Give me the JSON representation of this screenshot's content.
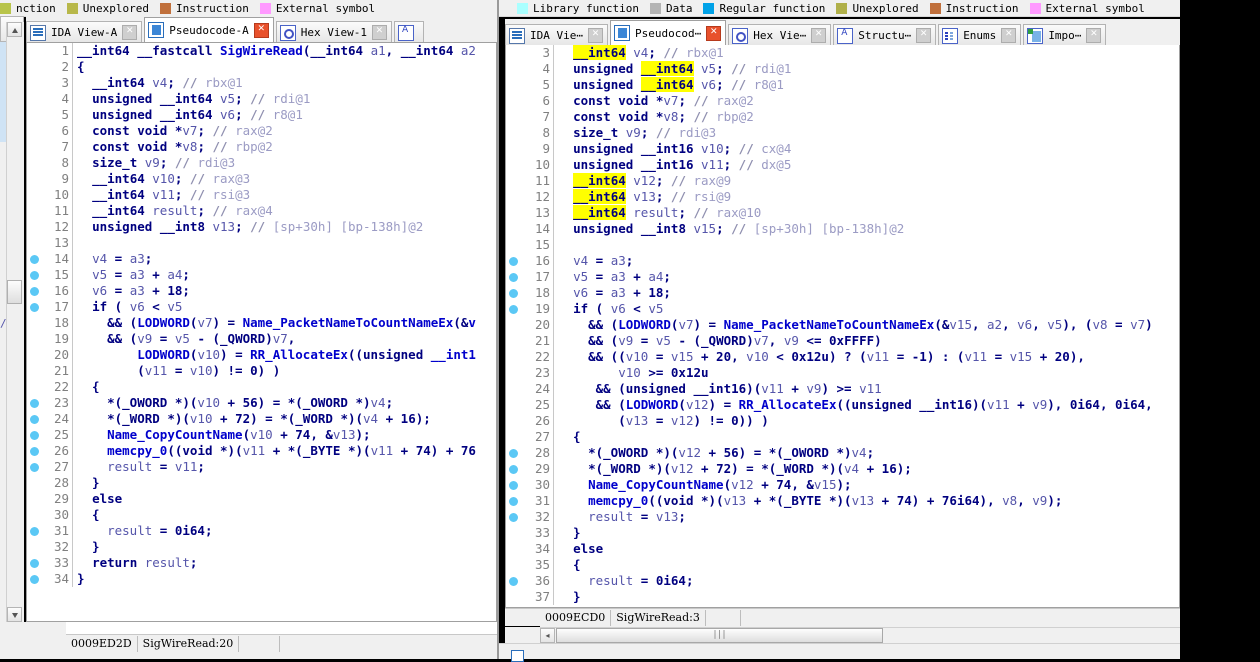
{
  "legend": {
    "left_items": [
      {
        "label": "nction",
        "color": "#b8c44a"
      },
      {
        "label": "Unexplored",
        "color": "#b8b84a"
      },
      {
        "label": "Instruction",
        "color": "#c0703c"
      },
      {
        "label": "External symbol",
        "color": "#ff99ff"
      }
    ],
    "right_items": [
      {
        "label": "Library function",
        "color": "#aaffff"
      },
      {
        "label": "Data",
        "color": "#b4b4b4"
      },
      {
        "label": "Regular function",
        "color": "#00a2e8"
      },
      {
        "label": "Unexplored",
        "color": "#b0b04a"
      },
      {
        "label": "Instruction",
        "color": "#c0703c"
      },
      {
        "label": "External symbol",
        "color": "#ff99ff"
      }
    ]
  },
  "left_window": {
    "close_button": "✕",
    "tabs": [
      {
        "label": "IDA View-A",
        "icon": "document-icon",
        "active": false,
        "close": "✕"
      },
      {
        "label": "Pseudocode-A",
        "icon": "pseudocode-icon",
        "active": true,
        "close": "✕"
      },
      {
        "label": "Hex View-1",
        "icon": "hexview-icon",
        "active": false,
        "close": "✕"
      },
      {
        "label": "",
        "icon": "structures-icon",
        "active": false,
        "close": ""
      }
    ],
    "status": {
      "address": "0009ED2D",
      "location": "SigWireRead:20"
    },
    "code": [
      {
        "n": 1,
        "bp": false,
        "text": "__int64 __fastcall SigWireRead(__int64 a1, __int64 a2"
      },
      {
        "n": 2,
        "bp": false,
        "text": "{"
      },
      {
        "n": 3,
        "bp": false,
        "text": "  __int64 v4; // rbx@1"
      },
      {
        "n": 4,
        "bp": false,
        "text": "  unsigned __int64 v5; // rdi@1"
      },
      {
        "n": 5,
        "bp": false,
        "text": "  unsigned __int64 v6; // r8@1"
      },
      {
        "n": 6,
        "bp": false,
        "text": "  const void *v7; // rax@2"
      },
      {
        "n": 7,
        "bp": false,
        "text": "  const void *v8; // rbp@2"
      },
      {
        "n": 8,
        "bp": false,
        "text": "  size_t v9; // rdi@3"
      },
      {
        "n": 9,
        "bp": false,
        "text": "  __int64 v10; // rax@3"
      },
      {
        "n": 10,
        "bp": false,
        "text": "  __int64 v11; // rsi@3"
      },
      {
        "n": 11,
        "bp": false,
        "text": "  __int64 result; // rax@4"
      },
      {
        "n": 12,
        "bp": false,
        "text": "  unsigned __int8 v13; // [sp+30h] [bp-138h]@2"
      },
      {
        "n": 13,
        "bp": false,
        "text": ""
      },
      {
        "n": 14,
        "bp": true,
        "text": "  v4 = a3;"
      },
      {
        "n": 15,
        "bp": true,
        "text": "  v5 = a3 + a4;"
      },
      {
        "n": 16,
        "bp": true,
        "text": "  v6 = a3 + 18;"
      },
      {
        "n": 17,
        "bp": true,
        "text": "  if ( v6 < v5"
      },
      {
        "n": 18,
        "bp": false,
        "text": "    && (LODWORD(v7) = Name_PacketNameToCountNameEx(&v"
      },
      {
        "n": 19,
        "bp": false,
        "text": "    && (v9 = v5 - (_QWORD)v7,"
      },
      {
        "n": 20,
        "bp": false,
        "text": "        LODWORD(v10) = RR_AllocateEx((unsigned __int1"
      },
      {
        "n": 21,
        "bp": false,
        "text": "        (v11 = v10) != 0) )"
      },
      {
        "n": 22,
        "bp": false,
        "text": "  {"
      },
      {
        "n": 23,
        "bp": true,
        "text": "    *(_OWORD *)(v10 + 56) = *(_OWORD *)v4;"
      },
      {
        "n": 24,
        "bp": true,
        "text": "    *(_WORD *)(v10 + 72) = *(_WORD *)(v4 + 16);"
      },
      {
        "n": 25,
        "bp": true,
        "text": "    Name_CopyCountName(v10 + 74, &v13);"
      },
      {
        "n": 26,
        "bp": true,
        "text": "    memcpy_0((void *)(v11 + *(_BYTE *)(v11 + 74) + 76"
      },
      {
        "n": 27,
        "bp": true,
        "text": "    result = v11;"
      },
      {
        "n": 28,
        "bp": false,
        "text": "  }"
      },
      {
        "n": 29,
        "bp": false,
        "text": "  else"
      },
      {
        "n": 30,
        "bp": false,
        "text": "  {"
      },
      {
        "n": 31,
        "bp": true,
        "text": "    result = 0i64;"
      },
      {
        "n": 32,
        "bp": false,
        "text": "  }"
      },
      {
        "n": 33,
        "bp": true,
        "text": "  return result;"
      },
      {
        "n": 34,
        "bp": true,
        "text": "}"
      }
    ]
  },
  "right_window": {
    "tabs": [
      {
        "label": "IDA Vie⋯",
        "icon": "document-icon",
        "active": false,
        "close": "✕"
      },
      {
        "label": "Pseudocod⋯",
        "icon": "pseudocode-icon",
        "active": true,
        "close": "✕"
      },
      {
        "label": "Hex Vie⋯",
        "icon": "hexview-icon",
        "active": false,
        "close": "✕"
      },
      {
        "label": "Structu⋯",
        "icon": "structures-icon",
        "active": false,
        "close": "✕"
      },
      {
        "label": "Enums",
        "icon": "enums-icon",
        "active": false,
        "close": "✕"
      },
      {
        "label": "Impo⋯",
        "icon": "imports-icon",
        "active": false,
        "close": "✕"
      }
    ],
    "status": {
      "address": "0009ECD0",
      "location": "SigWireRead:3"
    },
    "hscroll": {
      "grip": "∣∣∣",
      "left_arrow": "◂"
    },
    "code": [
      {
        "n": 3,
        "bp": false,
        "text": "  __int64 v4; // rbx@1",
        "hl": [
          {
            "s": 2,
            "e": 9
          }
        ]
      },
      {
        "n": 4,
        "bp": false,
        "text": "  unsigned __int64 v5; // rdi@1",
        "hl": [
          {
            "s": 11,
            "e": 18
          }
        ]
      },
      {
        "n": 5,
        "bp": false,
        "text": "  unsigned __int64 v6; // r8@1",
        "hl": [
          {
            "s": 11,
            "e": 18
          }
        ]
      },
      {
        "n": 6,
        "bp": false,
        "text": "  const void *v7; // rax@2",
        "hl": []
      },
      {
        "n": 7,
        "bp": false,
        "text": "  const void *v8; // rbp@2",
        "hl": []
      },
      {
        "n": 8,
        "bp": false,
        "text": "  size_t v9; // rdi@3",
        "hl": []
      },
      {
        "n": 9,
        "bp": false,
        "text": "  unsigned __int16 v10; // cx@4",
        "hl": []
      },
      {
        "n": 10,
        "bp": false,
        "text": "  unsigned __int16 v11; // dx@5",
        "hl": []
      },
      {
        "n": 11,
        "bp": false,
        "text": "  __int64 v12; // rax@9",
        "hl": [
          {
            "s": 2,
            "e": 9
          }
        ]
      },
      {
        "n": 12,
        "bp": false,
        "text": "  __int64 v13; // rsi@9",
        "hl": [
          {
            "s": 2,
            "e": 9
          }
        ]
      },
      {
        "n": 13,
        "bp": false,
        "text": "  __int64 result; // rax@10",
        "hl": [
          {
            "s": 2,
            "e": 9
          }
        ]
      },
      {
        "n": 14,
        "bp": false,
        "text": "  unsigned __int8 v15; // [sp+30h] [bp-138h]@2",
        "hl": []
      },
      {
        "n": 15,
        "bp": false,
        "text": "",
        "hl": []
      },
      {
        "n": 16,
        "bp": true,
        "text": "  v4 = a3;",
        "hl": []
      },
      {
        "n": 17,
        "bp": true,
        "text": "  v5 = a3 + a4;",
        "hl": []
      },
      {
        "n": 18,
        "bp": true,
        "text": "  v6 = a3 + 18;",
        "hl": []
      },
      {
        "n": 19,
        "bp": true,
        "text": "  if ( v6 < v5",
        "hl": []
      },
      {
        "n": 20,
        "bp": false,
        "text": "    && (LODWORD(v7) = Name_PacketNameToCountNameEx(&v15, a2, v6, v5), (v8 = v7)",
        "hl": []
      },
      {
        "n": 21,
        "bp": false,
        "text": "    && (v9 = v5 - (_QWORD)v7, v9 <= 0xFFFF)",
        "hl": []
      },
      {
        "n": 22,
        "bp": false,
        "text": "    && ((v10 = v15 + 20, v10 < 0x12u) ? (v11 = -1) : (v11 = v15 + 20),",
        "hl": []
      },
      {
        "n": 23,
        "bp": false,
        "text": "        v10 >= 0x12u",
        "hl": []
      },
      {
        "n": 24,
        "bp": false,
        "text": "     && (unsigned __int16)(v11 + v9) >= v11",
        "hl": []
      },
      {
        "n": 25,
        "bp": false,
        "text": "     && (LODWORD(v12) = RR_AllocateEx((unsigned __int16)(v11 + v9), 0i64, 0i64,",
        "hl": []
      },
      {
        "n": 26,
        "bp": false,
        "text": "        (v13 = v12) != 0)) )",
        "hl": []
      },
      {
        "n": 27,
        "bp": false,
        "text": "  {",
        "hl": []
      },
      {
        "n": 28,
        "bp": true,
        "text": "    *(_OWORD *)(v12 + 56) = *(_OWORD *)v4;",
        "hl": []
      },
      {
        "n": 29,
        "bp": true,
        "text": "    *(_WORD *)(v12 + 72) = *(_WORD *)(v4 + 16);",
        "hl": []
      },
      {
        "n": 30,
        "bp": true,
        "text": "    Name_CopyCountName(v12 + 74, &v15);",
        "hl": []
      },
      {
        "n": 31,
        "bp": true,
        "text": "    memcpy_0((void *)(v13 + *(_BYTE *)(v13 + 74) + 76i64), v8, v9);",
        "hl": []
      },
      {
        "n": 32,
        "bp": true,
        "text": "    result = v13;",
        "hl": []
      },
      {
        "n": 33,
        "bp": false,
        "text": "  }",
        "hl": []
      },
      {
        "n": 34,
        "bp": false,
        "text": "  else",
        "hl": []
      },
      {
        "n": 35,
        "bp": false,
        "text": "  {",
        "hl": []
      },
      {
        "n": 36,
        "bp": true,
        "text": "    result = 0i64;",
        "hl": []
      },
      {
        "n": 37,
        "bp": false,
        "text": "  }",
        "hl": []
      }
    ]
  }
}
